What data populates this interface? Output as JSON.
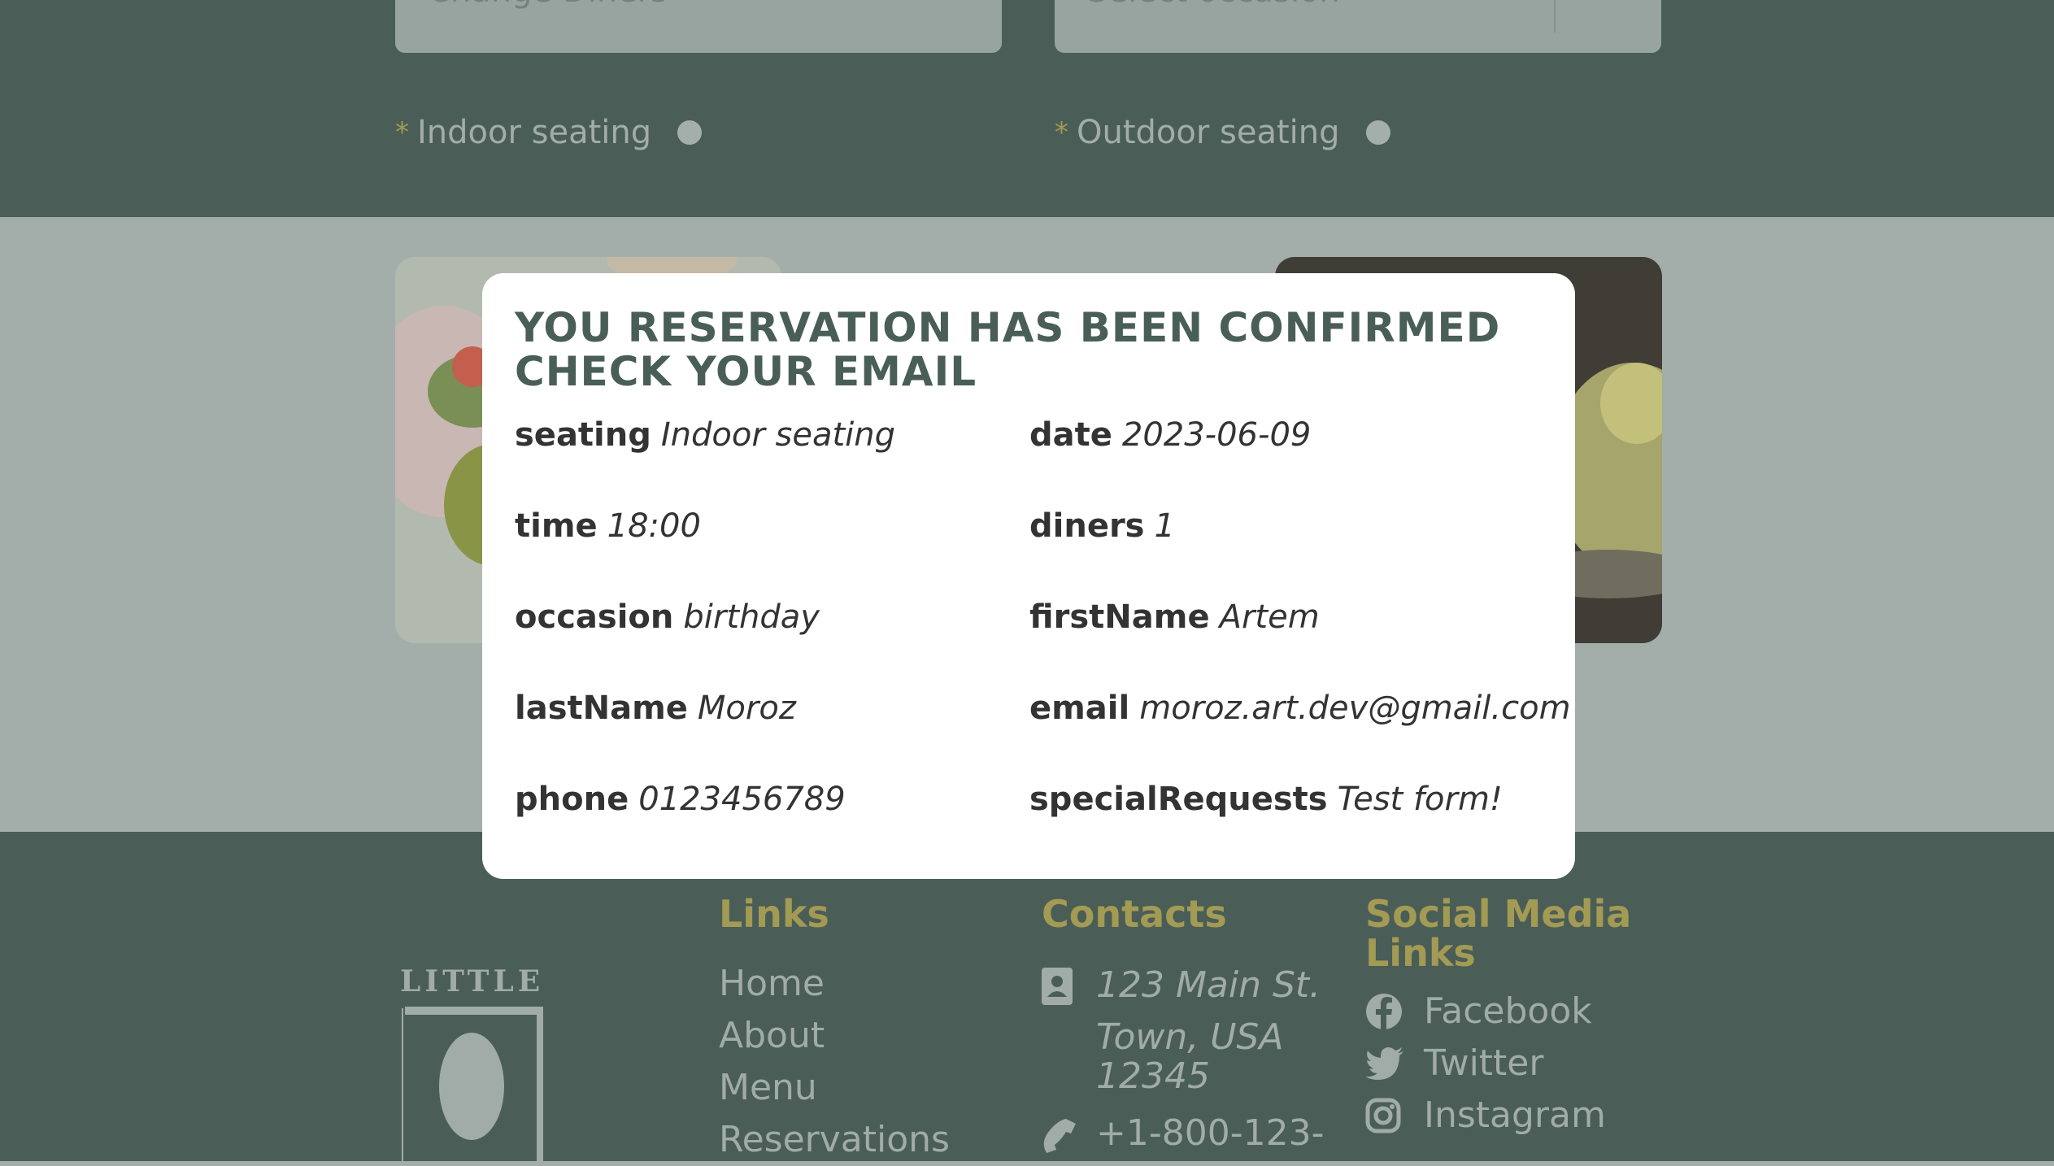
{
  "form": {
    "radio_indoor_label": "Indoor seating",
    "radio_outdoor_label": "Outdoor seating",
    "required_mark": "*"
  },
  "modal": {
    "title_line1": "YOU RESERVATION HAS BEEN CONFIRMED",
    "title_line2": "CHECK YOUR EMAIL",
    "fields": [
      {
        "key": "seating",
        "value": "Indoor seating"
      },
      {
        "key": "date",
        "value": "2023-06-09"
      },
      {
        "key": "time",
        "value": "18:00"
      },
      {
        "key": "diners",
        "value": "1"
      },
      {
        "key": "occasion",
        "value": "birthday"
      },
      {
        "key": "firstName",
        "value": "Artem"
      },
      {
        "key": "lastName",
        "value": "Moroz"
      },
      {
        "key": "email",
        "value": "moroz.art.dev@gmail.com"
      },
      {
        "key": "phone",
        "value": "0123456789"
      },
      {
        "key": "specialRequests",
        "value": "Test form!"
      }
    ]
  },
  "footer": {
    "logo_text": "LITTLE",
    "links_heading": "Links",
    "links": [
      "Home",
      "About",
      "Menu",
      "Reservations"
    ],
    "contacts_heading": "Contacts",
    "address_line1": "123 Main St.",
    "address_line2": "Town, USA",
    "address_line3": "12345",
    "phone": "+1-800-123-",
    "social_heading_line1": "Social Media",
    "social_heading_line2": "Links",
    "social": [
      {
        "label": "Facebook",
        "icon": "facebook-icon"
      },
      {
        "label": "Twitter",
        "icon": "twitter-icon"
      },
      {
        "label": "Instagram",
        "icon": "instagram-icon"
      }
    ]
  },
  "colors": {
    "primary_green": "#495e57",
    "accent_yellow": "#a39a54",
    "overlay_dim": "#a3aeaa"
  }
}
